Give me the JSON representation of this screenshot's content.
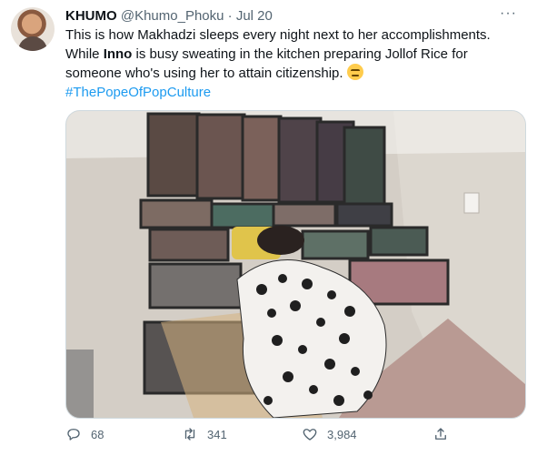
{
  "tweet": {
    "author_name": "KHUMO",
    "handle": "@Khumo_Phoku",
    "separator": "·",
    "date": "Jul 20",
    "more_label": "···",
    "text_part1": "This is how Makhadzi sleeps every night next to her accomplishments. While ",
    "bold_word": "Inno",
    "text_part2": " is busy sweating in the kitchen preparing Jollof Rice for someone who's using her to attain citizenship. ",
    "emoji": "pensive-face-emoji",
    "hashtag": "#ThePopeOfPopCulture"
  },
  "actions": {
    "reply_count": "68",
    "retweet_count": "341",
    "like_count": "3,984"
  },
  "icons": {
    "reply": "reply-icon",
    "retweet": "retweet-icon",
    "like": "heart-icon",
    "share": "share-icon"
  },
  "colors": {
    "link": "#1d9bf0",
    "muted": "#536471",
    "text": "#0f1419"
  }
}
